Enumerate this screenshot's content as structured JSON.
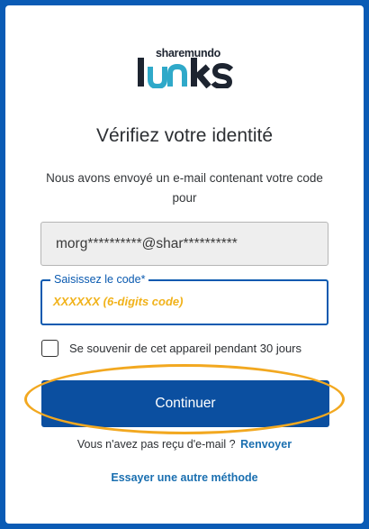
{
  "brand": {
    "small_text": "sharemundo",
    "big_text": "links",
    "colors": {
      "dark": "#1d2430",
      "accent": "#2fa9c9"
    }
  },
  "page": {
    "title": "Vérifiez votre identité",
    "subtitle": "Nous avons envoyé un e-mail contenant votre code pour"
  },
  "email": {
    "masked_value": "morg**********@shar**********"
  },
  "code_field": {
    "label": "Saisissez le code*",
    "placeholder": "XXXXXX (6-digits code)",
    "placeholder_color": "#f1b21a"
  },
  "remember": {
    "label": "Se souvenir de cet appareil pendant 30 jours",
    "checked": false
  },
  "actions": {
    "continue_label": "Continuer",
    "resend_prompt": "Vous n'avez pas reçu d'e-mail ?",
    "resend_label": "Renvoyer",
    "alt_method_label": "Essayer une autre méthode"
  },
  "colors": {
    "background": "#0a5bb5",
    "primary_button": "#0b4fa0",
    "link": "#1a6fb0",
    "highlight_annotation": "#f2a820"
  }
}
